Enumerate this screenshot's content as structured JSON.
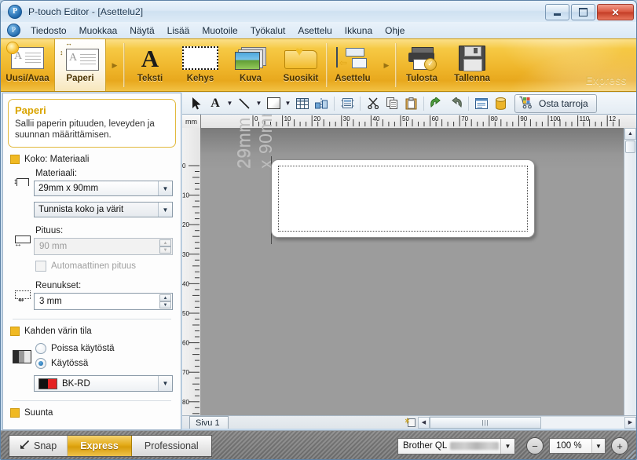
{
  "window": {
    "title": "P-touch Editor - [Asettelu2]",
    "app_icon": "ptouch-logo-icon",
    "buttons": {
      "minimize": "–",
      "maximize": "▫",
      "close": "✕"
    }
  },
  "menubar": {
    "items": [
      {
        "label": "Tiedosto",
        "accel": "T"
      },
      {
        "label": "Muokkaa",
        "accel": "M"
      },
      {
        "label": "Näytä",
        "accel": "N"
      },
      {
        "label": "Lisää",
        "accel": "L"
      },
      {
        "label": "Muotoile",
        "accel": "u"
      },
      {
        "label": "Työkalut",
        "accel": "y"
      },
      {
        "label": "Asettelu",
        "accel": "A"
      },
      {
        "label": "Ikkuna",
        "accel": "I"
      },
      {
        "label": "Ohje",
        "accel": "O"
      }
    ]
  },
  "ribbon": {
    "watermark": "Express",
    "groups": [
      {
        "buttons": [
          {
            "label": "Uusi/Avaa",
            "icon": "new-open-icon",
            "active": false
          },
          {
            "label": "Paperi",
            "icon": "paper-icon",
            "active": true
          }
        ],
        "overflow": "▶"
      },
      {
        "buttons": [
          {
            "label": "Teksti",
            "icon": "text-icon",
            "active": false
          },
          {
            "label": "Kehys",
            "icon": "frame-icon",
            "active": false
          },
          {
            "label": "Kuva",
            "icon": "image-icon",
            "active": false
          },
          {
            "label": "Suosikit",
            "icon": "favorites-icon",
            "active": false
          },
          {
            "label": "Asettelu",
            "icon": "layout-icon",
            "active": false
          }
        ],
        "overflow": "▶"
      },
      {
        "buttons": [
          {
            "label": "Tulosta",
            "icon": "print-icon",
            "active": false
          },
          {
            "label": "Tallenna",
            "icon": "save-icon",
            "active": false
          }
        ],
        "overflow": ""
      }
    ]
  },
  "panel": {
    "hint": {
      "title": "Paperi",
      "description": "Sallii paperin pituuden, leveyden ja suunnan määrittämisen."
    },
    "sections": [
      {
        "heading": "Koko: Materiaali"
      },
      {
        "heading": "Kahden värin tila"
      },
      {
        "heading": "Suunta"
      }
    ],
    "media_label": "Materiaali:",
    "media_value": "29mm x 90mm",
    "detect_value": "Tunnista koko ja värit",
    "length_label": "Pituus:",
    "length_value": "90 mm",
    "auto_length_label": "Automaattinen pituus",
    "auto_length_checked": false,
    "margins_label": "Reunukset:",
    "margins_value": "3 mm",
    "twocolor": {
      "heading": "Kahden värin tila",
      "option_off": "Poissa käytöstä",
      "option_on": "Käytössä",
      "selected": "Käytössä",
      "combo_value": "BK-RD",
      "swatch_black": "#111111",
      "swatch_red": "#e42222"
    },
    "orientation_heading": "Suunta"
  },
  "toolbar2": {
    "tools": [
      {
        "name": "select-arrow-icon"
      },
      {
        "name": "text-tool-icon"
      },
      {
        "name": "text-dropdown-caret-icon"
      },
      {
        "name": "line-tool-icon"
      },
      {
        "name": "line-dropdown-caret-icon"
      },
      {
        "name": "rectangle-tool-icon"
      },
      {
        "name": "rectangle-dropdown-caret-icon"
      },
      {
        "name": "table-tool-icon"
      },
      {
        "name": "align-tool-icon"
      },
      {
        "name": "database-print-icon"
      },
      {
        "name": "cut-icon"
      },
      {
        "name": "copy-icon"
      },
      {
        "name": "paste-icon"
      },
      {
        "name": "undo-icon"
      },
      {
        "name": "redo-icon"
      },
      {
        "name": "properties-icon"
      },
      {
        "name": "database-icon"
      }
    ],
    "buy_button": {
      "label": "Osta tarroja",
      "icon": "shopping-cart-icon"
    }
  },
  "workspace": {
    "unit": "mm",
    "h_ticks": [
      "0",
      "10",
      "20",
      "30",
      "40",
      "50",
      "60",
      "70",
      "80",
      "90",
      "100",
      "110",
      "12"
    ],
    "v_ticks": [
      "0",
      "10",
      "20",
      "30",
      "40",
      "50",
      "60",
      "70",
      "80"
    ],
    "label_watermark_line1": "29mm",
    "label_watermark_line2": "x 90mm"
  },
  "pagetabs": {
    "tabs": [
      "Sivu 1"
    ],
    "add_page_icon": "add-page-icon",
    "scroll_left": "◀",
    "scroll_right": "▶",
    "thumb_grip": "|||"
  },
  "bottombar": {
    "modes": [
      {
        "label": "Snap",
        "icon": "snap-icon",
        "selected": false
      },
      {
        "label": "Express",
        "icon": "",
        "selected": true
      },
      {
        "label": "Professional",
        "icon": "",
        "selected": false
      }
    ],
    "printer": "Brother QL",
    "zoom_out": "−",
    "zoom_in": "+",
    "zoom_value": "100 %"
  },
  "colors": {
    "ribbon_gold": "#efb62b",
    "accent_orange": "#e3ab18",
    "hint_border": "#e2b93d",
    "canvas_gray": "#9c9c9c"
  }
}
